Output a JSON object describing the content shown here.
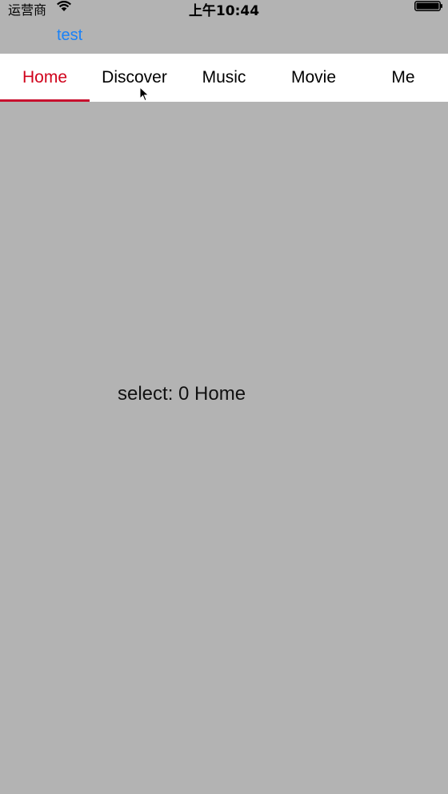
{
  "status_bar": {
    "carrier": "运营商",
    "time": "上午10:44",
    "wifi_icon": "wifi-icon",
    "battery_icon": "battery-icon"
  },
  "nav": {
    "back_label": "test"
  },
  "tabs": [
    {
      "label": "Home",
      "active": true
    },
    {
      "label": "Discover",
      "active": false
    },
    {
      "label": "Music",
      "active": false
    },
    {
      "label": "Movie",
      "active": false
    },
    {
      "label": "Me",
      "active": false
    }
  ],
  "content": {
    "selection_text": "select: 0 Home"
  },
  "colors": {
    "background": "#b3b3b3",
    "accent_active": "#d0021b",
    "link": "#1a82f7",
    "tab_bar": "#ffffff"
  }
}
